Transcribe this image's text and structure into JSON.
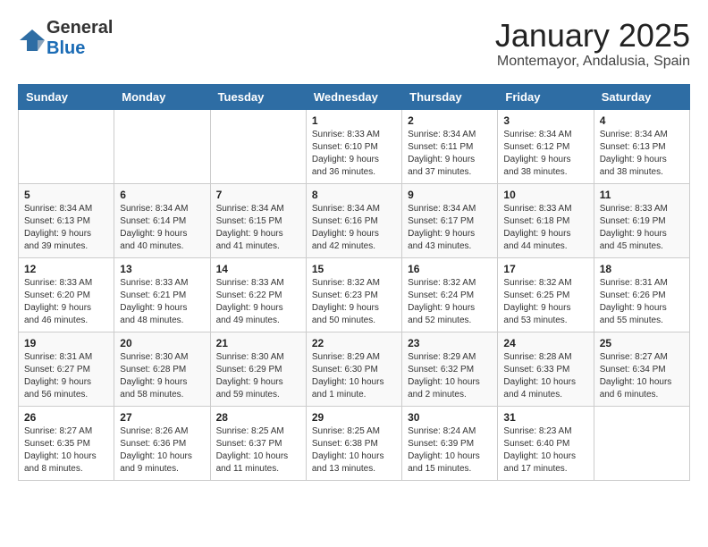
{
  "logo": {
    "text_general": "General",
    "text_blue": "Blue"
  },
  "title": "January 2025",
  "location": "Montemayor, Andalusia, Spain",
  "days_of_week": [
    "Sunday",
    "Monday",
    "Tuesday",
    "Wednesday",
    "Thursday",
    "Friday",
    "Saturday"
  ],
  "weeks": [
    [
      {
        "day": "",
        "info": ""
      },
      {
        "day": "",
        "info": ""
      },
      {
        "day": "",
        "info": ""
      },
      {
        "day": "1",
        "info": "Sunrise: 8:33 AM\nSunset: 6:10 PM\nDaylight: 9 hours and 36 minutes."
      },
      {
        "day": "2",
        "info": "Sunrise: 8:34 AM\nSunset: 6:11 PM\nDaylight: 9 hours and 37 minutes."
      },
      {
        "day": "3",
        "info": "Sunrise: 8:34 AM\nSunset: 6:12 PM\nDaylight: 9 hours and 38 minutes."
      },
      {
        "day": "4",
        "info": "Sunrise: 8:34 AM\nSunset: 6:13 PM\nDaylight: 9 hours and 38 minutes."
      }
    ],
    [
      {
        "day": "5",
        "info": "Sunrise: 8:34 AM\nSunset: 6:13 PM\nDaylight: 9 hours and 39 minutes."
      },
      {
        "day": "6",
        "info": "Sunrise: 8:34 AM\nSunset: 6:14 PM\nDaylight: 9 hours and 40 minutes."
      },
      {
        "day": "7",
        "info": "Sunrise: 8:34 AM\nSunset: 6:15 PM\nDaylight: 9 hours and 41 minutes."
      },
      {
        "day": "8",
        "info": "Sunrise: 8:34 AM\nSunset: 6:16 PM\nDaylight: 9 hours and 42 minutes."
      },
      {
        "day": "9",
        "info": "Sunrise: 8:34 AM\nSunset: 6:17 PM\nDaylight: 9 hours and 43 minutes."
      },
      {
        "day": "10",
        "info": "Sunrise: 8:33 AM\nSunset: 6:18 PM\nDaylight: 9 hours and 44 minutes."
      },
      {
        "day": "11",
        "info": "Sunrise: 8:33 AM\nSunset: 6:19 PM\nDaylight: 9 hours and 45 minutes."
      }
    ],
    [
      {
        "day": "12",
        "info": "Sunrise: 8:33 AM\nSunset: 6:20 PM\nDaylight: 9 hours and 46 minutes."
      },
      {
        "day": "13",
        "info": "Sunrise: 8:33 AM\nSunset: 6:21 PM\nDaylight: 9 hours and 48 minutes."
      },
      {
        "day": "14",
        "info": "Sunrise: 8:33 AM\nSunset: 6:22 PM\nDaylight: 9 hours and 49 minutes."
      },
      {
        "day": "15",
        "info": "Sunrise: 8:32 AM\nSunset: 6:23 PM\nDaylight: 9 hours and 50 minutes."
      },
      {
        "day": "16",
        "info": "Sunrise: 8:32 AM\nSunset: 6:24 PM\nDaylight: 9 hours and 52 minutes."
      },
      {
        "day": "17",
        "info": "Sunrise: 8:32 AM\nSunset: 6:25 PM\nDaylight: 9 hours and 53 minutes."
      },
      {
        "day": "18",
        "info": "Sunrise: 8:31 AM\nSunset: 6:26 PM\nDaylight: 9 hours and 55 minutes."
      }
    ],
    [
      {
        "day": "19",
        "info": "Sunrise: 8:31 AM\nSunset: 6:27 PM\nDaylight: 9 hours and 56 minutes."
      },
      {
        "day": "20",
        "info": "Sunrise: 8:30 AM\nSunset: 6:28 PM\nDaylight: 9 hours and 58 minutes."
      },
      {
        "day": "21",
        "info": "Sunrise: 8:30 AM\nSunset: 6:29 PM\nDaylight: 9 hours and 59 minutes."
      },
      {
        "day": "22",
        "info": "Sunrise: 8:29 AM\nSunset: 6:30 PM\nDaylight: 10 hours and 1 minute."
      },
      {
        "day": "23",
        "info": "Sunrise: 8:29 AM\nSunset: 6:32 PM\nDaylight: 10 hours and 2 minutes."
      },
      {
        "day": "24",
        "info": "Sunrise: 8:28 AM\nSunset: 6:33 PM\nDaylight: 10 hours and 4 minutes."
      },
      {
        "day": "25",
        "info": "Sunrise: 8:27 AM\nSunset: 6:34 PM\nDaylight: 10 hours and 6 minutes."
      }
    ],
    [
      {
        "day": "26",
        "info": "Sunrise: 8:27 AM\nSunset: 6:35 PM\nDaylight: 10 hours and 8 minutes."
      },
      {
        "day": "27",
        "info": "Sunrise: 8:26 AM\nSunset: 6:36 PM\nDaylight: 10 hours and 9 minutes."
      },
      {
        "day": "28",
        "info": "Sunrise: 8:25 AM\nSunset: 6:37 PM\nDaylight: 10 hours and 11 minutes."
      },
      {
        "day": "29",
        "info": "Sunrise: 8:25 AM\nSunset: 6:38 PM\nDaylight: 10 hours and 13 minutes."
      },
      {
        "day": "30",
        "info": "Sunrise: 8:24 AM\nSunset: 6:39 PM\nDaylight: 10 hours and 15 minutes."
      },
      {
        "day": "31",
        "info": "Sunrise: 8:23 AM\nSunset: 6:40 PM\nDaylight: 10 hours and 17 minutes."
      },
      {
        "day": "",
        "info": ""
      }
    ]
  ]
}
